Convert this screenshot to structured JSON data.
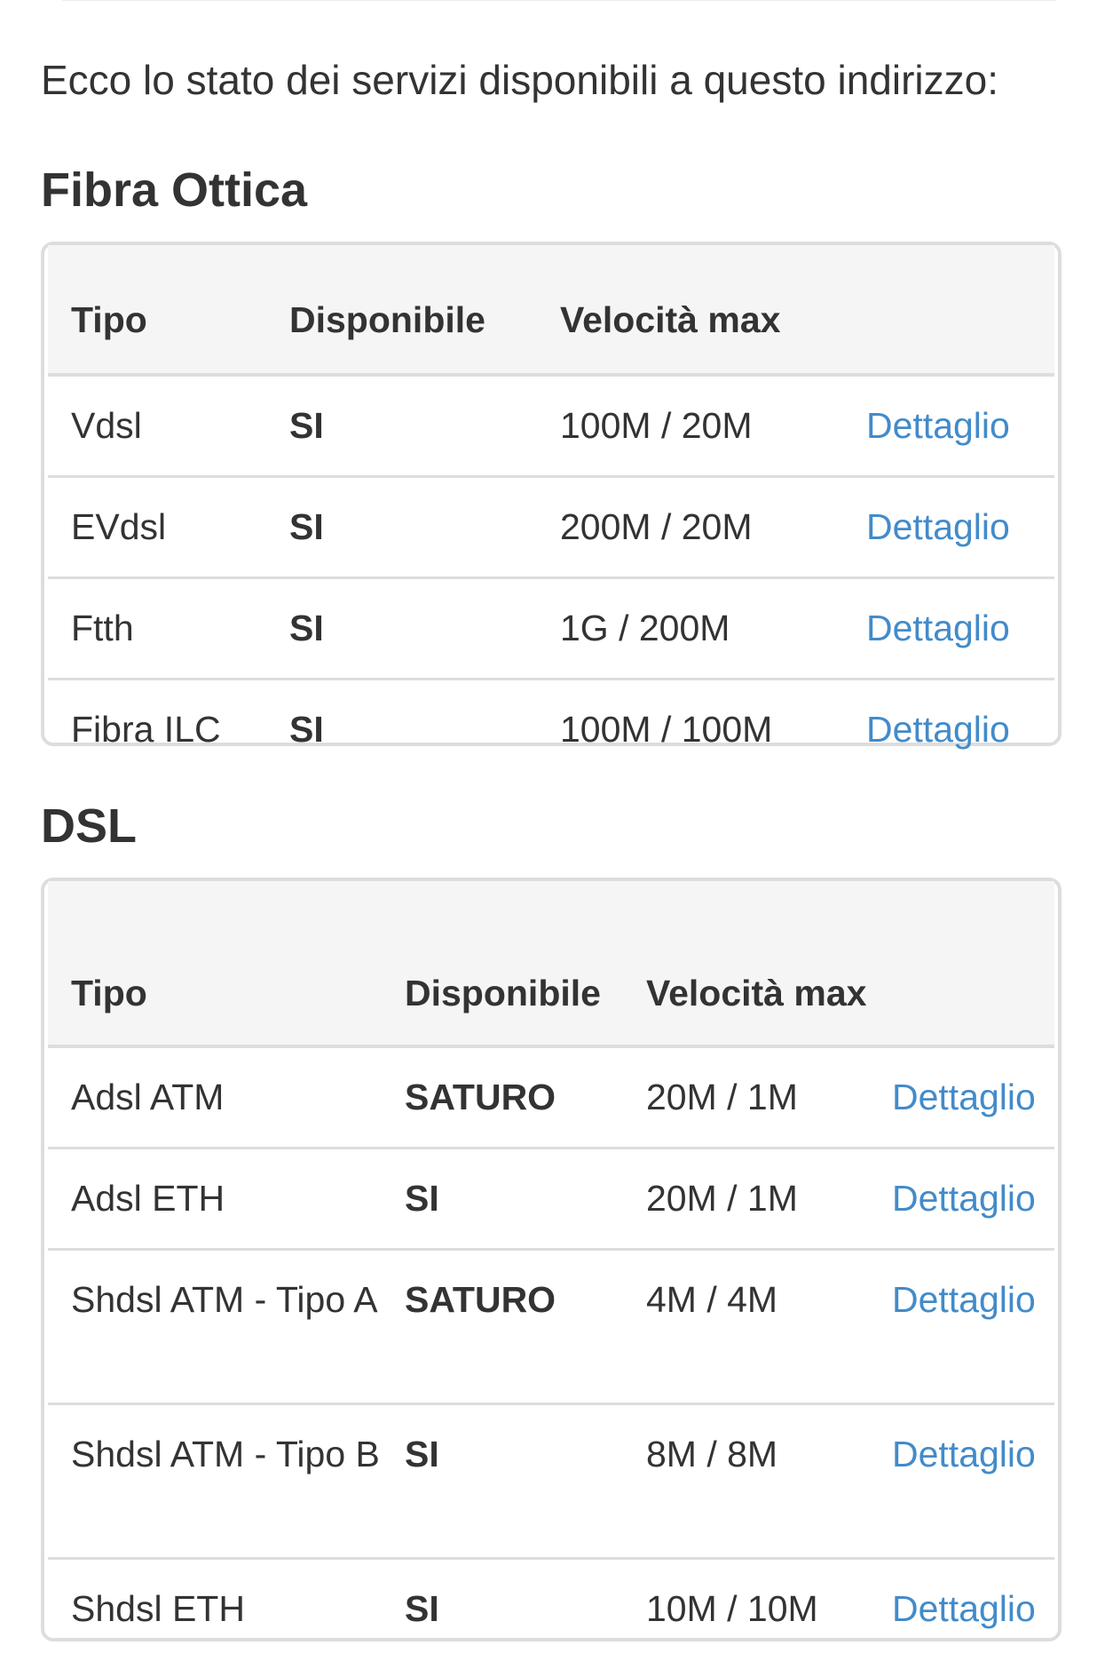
{
  "intro_text": "Ecco lo stato dei servizi disponibili a questo indirizzo:",
  "link_color": "#428bca",
  "fibra": {
    "title": "Fibra Ottica",
    "headers": [
      "Tipo",
      "Disponibile",
      "Velocità max",
      ""
    ],
    "rows": [
      {
        "tipo": "Vdsl",
        "disponibile": "SI",
        "velocita": "100M / 20M",
        "link": "Dettaglio"
      },
      {
        "tipo": "EVdsl",
        "disponibile": "SI",
        "velocita": "200M / 20M",
        "link": "Dettaglio"
      },
      {
        "tipo": "Ftth",
        "disponibile": "SI",
        "velocita": "1G / 200M",
        "link": "Dettaglio"
      },
      {
        "tipo": "Fibra ILC",
        "disponibile": "SI",
        "velocita": "100M / 100M",
        "link": "Dettaglio"
      }
    ]
  },
  "dsl": {
    "title": "DSL",
    "headers": [
      "Tipo",
      "Disponibile",
      "Velocità max",
      ""
    ],
    "rows": [
      {
        "tipo": "Adsl ATM",
        "disponibile": "SATURO",
        "velocita": "20M / 1M",
        "link": "Dettaglio"
      },
      {
        "tipo": "Adsl ETH",
        "disponibile": "SI",
        "velocita": "20M / 1M",
        "link": "Dettaglio"
      },
      {
        "tipo": "Shdsl ATM - Tipo A",
        "disponibile": "SATURO",
        "velocita": "4M / 4M",
        "link": "Dettaglio"
      },
      {
        "tipo": "Shdsl ATM - Tipo B",
        "disponibile": "SI",
        "velocita": "8M / 8M",
        "link": "Dettaglio"
      },
      {
        "tipo": "Shdsl ETH",
        "disponibile": "SI",
        "velocita": "10M / 10M",
        "link": "Dettaglio"
      }
    ]
  }
}
